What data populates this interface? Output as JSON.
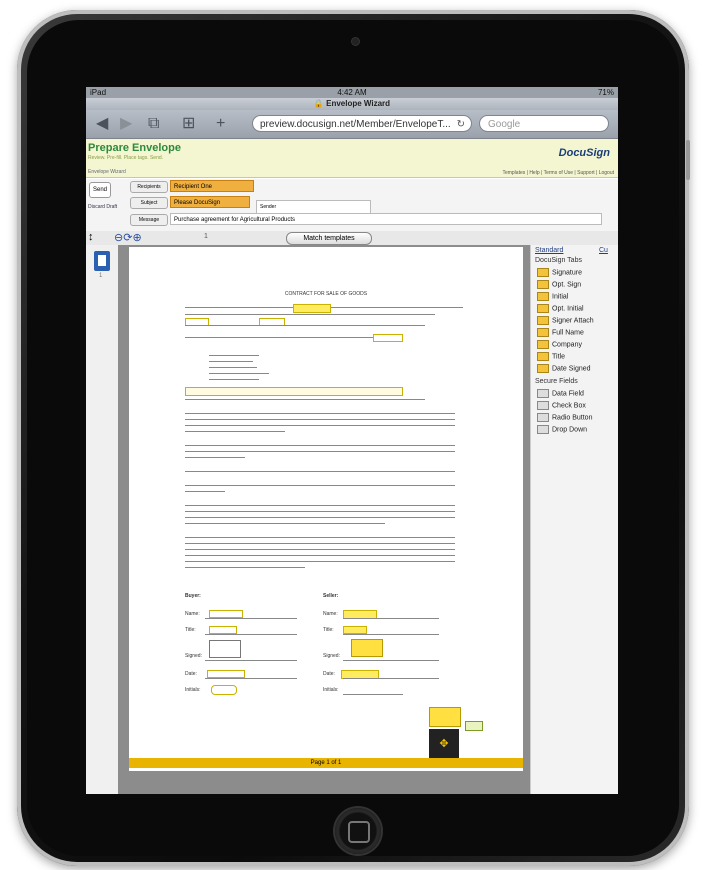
{
  "device": {
    "label": "iPad"
  },
  "status_bar": {
    "carrier": "iPad",
    "time": "4:42 AM",
    "battery": "71%"
  },
  "browser": {
    "title": "Envelope Wizard",
    "url": "preview.docusign.net/Member/EnvelopeT...",
    "search_placeholder": "Google"
  },
  "header": {
    "title": "Prepare Envelope",
    "subtitle": "Review. Pre-fill. Place tags. Send.",
    "brand": "DocuSign",
    "links": "Templates | Help | Terms of Use | Support | Logout",
    "breadcrumb": "Envelope Wizard"
  },
  "form": {
    "send_button": "Send",
    "discard_link": "Discard Draft",
    "rows": [
      {
        "label": "Recipients",
        "value": "Recipient One"
      },
      {
        "label": "Subject",
        "value": "Please DocuSign",
        "sender": "Sender"
      },
      {
        "label": "Message",
        "value": "Purchase agreement for Agricultural Products"
      }
    ]
  },
  "doc_toolbar": {
    "page_label": "1",
    "match_templates": "Match templates"
  },
  "thumbnails": [
    {
      "page": "1"
    }
  ],
  "document": {
    "title": "CONTRACT FOR SALE OF GOODS",
    "page_footer": "Page 1 of 1",
    "buyer_heading": "Buyer:",
    "seller_heading": "Seller:",
    "buyer_fields": [
      "Name:",
      "Title:",
      "Signed:",
      "Date:",
      "Initials:"
    ],
    "seller_fields": [
      "Name:",
      "Title:",
      "Signed:",
      "Date:",
      "Initials:"
    ]
  },
  "palette": {
    "tabs": [
      "Standard",
      "Cu"
    ],
    "sections": [
      {
        "heading": "DocuSign Tabs",
        "items": [
          "Signature",
          "Opt. Sign",
          "Initial",
          "Opt. Initial",
          "Signer Attach",
          "Full Name",
          "Company",
          "Title",
          "Date Signed"
        ]
      },
      {
        "heading": "Secure Fields",
        "items": [
          "Data Field",
          "Check Box",
          "Radio Button",
          "Drop Down"
        ]
      }
    ]
  }
}
